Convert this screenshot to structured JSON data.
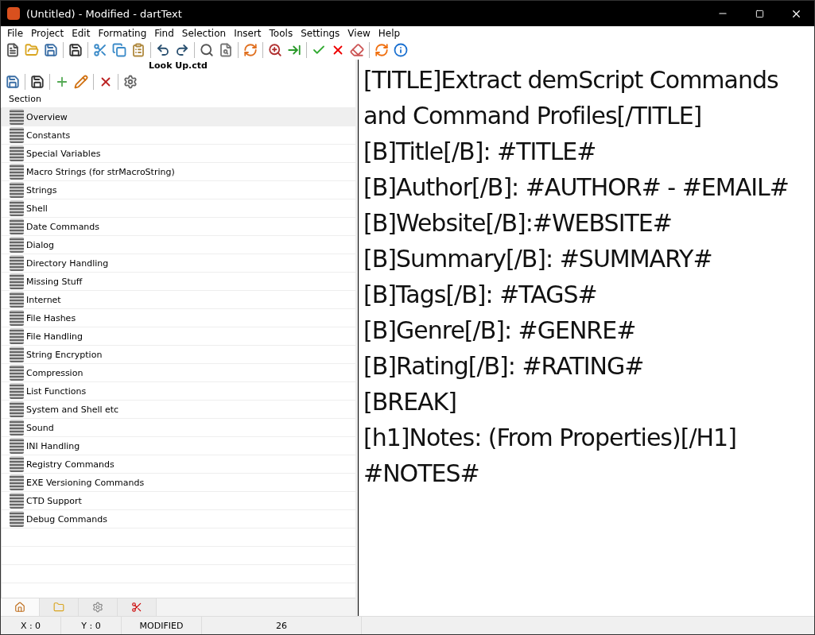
{
  "window": {
    "title": "(Untitled) - Modified - dartText"
  },
  "menu": [
    "File",
    "Project",
    "Edit",
    "Formating",
    "Find",
    "Selection",
    "Insert",
    "Tools",
    "Settings",
    "View",
    "Help"
  ],
  "project": {
    "title": "Look Up.ctd",
    "column_header": "Section",
    "items": [
      {
        "label": "Overview",
        "selected": true
      },
      {
        "label": "Constants",
        "selected": false
      },
      {
        "label": "Special Variables",
        "selected": false
      },
      {
        "label": "Macro Strings (for strMacroString)",
        "selected": false
      },
      {
        "label": "Strings",
        "selected": false
      },
      {
        "label": "Shell",
        "selected": false
      },
      {
        "label": "Date Commands",
        "selected": false
      },
      {
        "label": "Dialog",
        "selected": false
      },
      {
        "label": "Directory Handling",
        "selected": false
      },
      {
        "label": "Missing Stuff",
        "selected": false
      },
      {
        "label": "Internet",
        "selected": false
      },
      {
        "label": "File Hashes",
        "selected": false
      },
      {
        "label": "File Handling",
        "selected": false
      },
      {
        "label": "String Encryption",
        "selected": false
      },
      {
        "label": "Compression",
        "selected": false
      },
      {
        "label": "List Functions",
        "selected": false
      },
      {
        "label": "System and Shell etc",
        "selected": false
      },
      {
        "label": "Sound",
        "selected": false
      },
      {
        "label": "INI Handling",
        "selected": false
      },
      {
        "label": "Registry Commands",
        "selected": false
      },
      {
        "label": "EXE Versioning Commands",
        "selected": false
      },
      {
        "label": "CTD Support",
        "selected": false
      },
      {
        "label": "Debug Commands",
        "selected": false
      }
    ]
  },
  "panel_tabs": [
    {
      "kind": "project",
      "selected": true
    },
    {
      "kind": "folder",
      "selected": false
    },
    {
      "kind": "settings",
      "selected": false
    },
    {
      "kind": "cut",
      "selected": false
    }
  ],
  "editor": {
    "lines": [
      "[TITLE]Extract demScript Commands",
      "and Command Profiles[/TITLE]",
      "[B]Title[/B]: #TITLE#",
      "[B]Author[/B]: #AUTHOR# - #EMAIL#",
      "[B]Website[/B]:#WEBSITE#",
      "[B]Summary[/B]: #SUMMARY#",
      "[B]Tags[/B]: #TAGS#",
      "[B]Genre[/B]: #GENRE#",
      "[B]Rating[/B]: #RATING#",
      "[BREAK]",
      "[h1]Notes: (From Properties)[/H1]",
      "#NOTES#"
    ]
  },
  "status_bar": [
    "X : 0",
    "Y : 0",
    "MODIFIED",
    "26"
  ]
}
